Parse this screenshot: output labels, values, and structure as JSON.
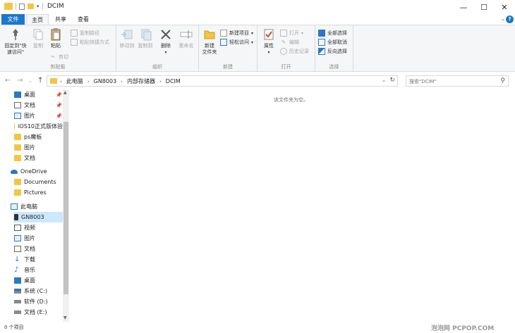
{
  "window": {
    "title": "DCIM",
    "minimize": "—",
    "maximize": "☐",
    "close": "✕"
  },
  "tabs": {
    "file": "文件",
    "home": "主页",
    "share": "共享",
    "view": "查看",
    "help": "?"
  },
  "ribbon": {
    "clipboard": {
      "label": "剪贴板",
      "pin_quick_access": "固定到\"快速访问\"",
      "copy": "复制",
      "paste": "粘贴",
      "copy_path": "复制路径",
      "paste_shortcut": "粘贴快捷方式",
      "cut": "剪切"
    },
    "organize": {
      "label": "组织",
      "move_to": "移动到",
      "copy_to": "复制到",
      "delete": "删除",
      "rename": "重命名"
    },
    "new": {
      "label": "新建",
      "new_folder": "新建\n文件夹",
      "new_item": "新建项目",
      "easy_access": "轻松访问"
    },
    "open": {
      "label": "打开",
      "properties": "属性",
      "open": "打开",
      "edit": "编辑",
      "history": "历史记录"
    },
    "select": {
      "label": "选择",
      "select_all": "全部选择",
      "select_none": "全部取消",
      "invert": "反向选择"
    }
  },
  "address": {
    "crumbs": [
      "此电脑",
      "GN8003",
      "内部存储器",
      "DCIM"
    ],
    "search_placeholder": "搜索\"DCIM\""
  },
  "nav": {
    "items": [
      {
        "label": "桌面",
        "icon": "desktop-icon",
        "pinned": true
      },
      {
        "label": "文档",
        "icon": "documents-icon",
        "pinned": true
      },
      {
        "label": "图片",
        "icon": "pictures-icon",
        "pinned": true
      },
      {
        "label": "iOS10正式版体验",
        "icon": "folder-icon",
        "pinned": false
      },
      {
        "label": "ps魔板",
        "icon": "folder-icon",
        "pinned": false
      },
      {
        "label": "图片",
        "icon": "folder-icon",
        "pinned": false
      },
      {
        "label": "文档",
        "icon": "folder-icon",
        "pinned": false
      },
      {
        "label": "OneDrive",
        "icon": "onedrive-icon",
        "pinned": false
      },
      {
        "label": "Documents",
        "icon": "folder-icon",
        "pinned": false
      },
      {
        "label": "Pictures",
        "icon": "folder-icon",
        "pinned": false
      },
      {
        "label": "此电脑",
        "icon": "computer-icon",
        "pinned": false
      },
      {
        "label": "GN8003",
        "icon": "phone-icon",
        "pinned": false
      },
      {
        "label": "视频",
        "icon": "videos-icon",
        "pinned": false
      },
      {
        "label": "图片",
        "icon": "pictures-icon",
        "pinned": false
      },
      {
        "label": "文档",
        "icon": "documents-icon",
        "pinned": false
      },
      {
        "label": "下载",
        "icon": "downloads-icon",
        "pinned": false
      },
      {
        "label": "音乐",
        "icon": "music-icon",
        "pinned": false
      },
      {
        "label": "桌面",
        "icon": "desktop-icon",
        "pinned": false
      },
      {
        "label": "系统 (C:)",
        "icon": "drive-icon",
        "pinned": false
      },
      {
        "label": "软件 (D:)",
        "icon": "drive-icon",
        "pinned": false
      },
      {
        "label": "文档 (E:)",
        "icon": "drive-icon",
        "pinned": false
      }
    ]
  },
  "content": {
    "empty_message": "该文件夹为空。"
  },
  "status": {
    "item_count": "0 个项目",
    "watermark": "泡泡网 PCPOP.COM"
  },
  "colors": {
    "accent": "#1979ca",
    "folder": "#f4c542",
    "selected": "#cce8ff"
  }
}
